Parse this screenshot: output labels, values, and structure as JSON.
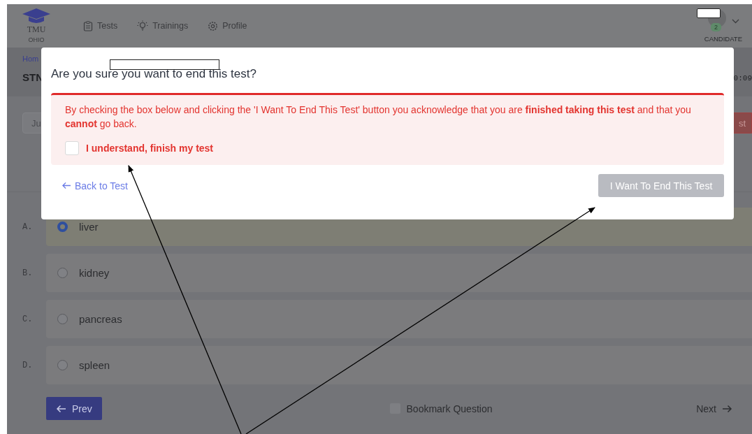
{
  "header": {
    "logo": {
      "name": "TMU",
      "subtitle": "OHIO"
    },
    "nav": [
      {
        "label": "Tests"
      },
      {
        "label": "Trainings"
      },
      {
        "label": "Profile"
      }
    ],
    "user": {
      "badge": "2",
      "role": "CANDIDATE"
    }
  },
  "page": {
    "breadcrumb": "Hom",
    "title": "STN",
    "timer": "0:09",
    "search_value": "Ju",
    "action_button": "st"
  },
  "question": {
    "options": [
      {
        "letter": "A.",
        "text": "liver",
        "selected": true
      },
      {
        "letter": "B.",
        "text": "kidney",
        "selected": false
      },
      {
        "letter": "C.",
        "text": "pancreas",
        "selected": false
      },
      {
        "letter": "D.",
        "text": "spleen",
        "selected": false
      }
    ]
  },
  "footer": {
    "prev": "Prev",
    "bookmark": {
      "label": "Bookmark Question",
      "checked": false
    },
    "next": "Next"
  },
  "dialog": {
    "title": "Are you sure you want to end this test?",
    "warning": "By checking the box below and clicking the 'I Want To End This Test' button you acknowledge that you are **finished taking this test** and that you **cannot** go back.",
    "confirm": {
      "label": "I understand, finish my test",
      "checked": false
    },
    "back": "Back to Test",
    "end_button": {
      "label": "I Want To End This Test",
      "disabled": true
    }
  }
}
